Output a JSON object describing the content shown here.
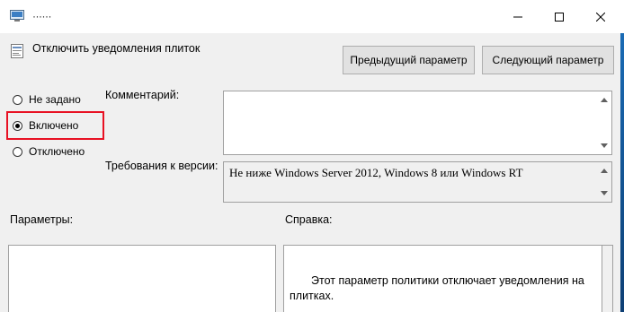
{
  "window": {
    "title": "······",
    "controls": [
      "minimize-icon",
      "maximize-icon",
      "close-icon"
    ]
  },
  "setting": {
    "title": "Отключить уведомления плиток"
  },
  "nav": {
    "prev_label": "Предыдущий параметр",
    "next_label": "Следующий параметр"
  },
  "state_options": [
    {
      "label": "Не задано",
      "checked": false
    },
    {
      "label": "Включено",
      "checked": true
    },
    {
      "label": "Отключено",
      "checked": false
    }
  ],
  "comment": {
    "label": "Комментарий:",
    "value": ""
  },
  "version": {
    "label": "Требования к версии:",
    "value": "Не ниже Windows Server 2012, Windows 8 или Windows RT"
  },
  "params": {
    "label": "Параметры:"
  },
  "help": {
    "label": "Справка:",
    "text": "Этот параметр политики отключает уведомления на плитках."
  },
  "colors": {
    "highlight": "#e81123",
    "background": "#f0f0f0"
  }
}
